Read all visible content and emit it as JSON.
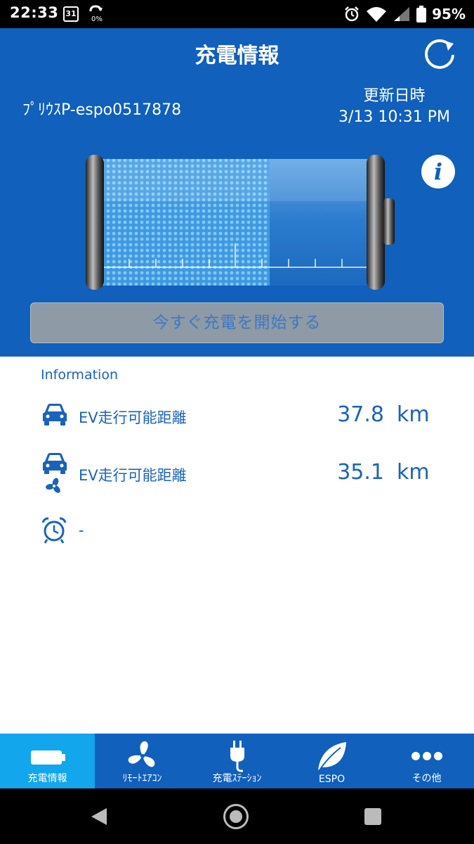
{
  "status_bar": {
    "time": "22:33",
    "calendar_day": "31",
    "battery_percent": "95%"
  },
  "header": {
    "title": "充電情報",
    "vehicle_name": "ﾌﾟﾘｳｽP-espo0517878",
    "update_label": "更新日時",
    "update_time": "3/13 10:31 PM",
    "info_symbol": "i",
    "charge_level": 0.65,
    "charge_button_label": "今すぐ充電を開始する"
  },
  "information": {
    "heading": "Information",
    "rows": [
      {
        "icon": "car-icon",
        "label": "EV走行可能距離",
        "value": "37.8",
        "unit": "km"
      },
      {
        "icon": "car-fan-icon",
        "label": "EV走行可能距離",
        "value": "35.1",
        "unit": "km"
      },
      {
        "icon": "alarm-clock-icon",
        "label": "-"
      }
    ]
  },
  "tabs": [
    {
      "label": "充電情報",
      "icon": "battery-icon",
      "active": true
    },
    {
      "label": "ﾘﾓｰﾄｴｱｺﾝ",
      "icon": "fan-icon",
      "active": false
    },
    {
      "label": "充電ｽﾃｰｼｮﾝ",
      "icon": "plug-icon",
      "active": false
    },
    {
      "label": "ESPO",
      "icon": "leaf-icon",
      "active": false
    },
    {
      "label": "その他",
      "icon": "more-icon",
      "active": false
    }
  ],
  "colors": {
    "primary": "#1060bc",
    "active_tab": "#12a6ec",
    "text_blue": "#1a63b8",
    "button_gray": "#8e9aa5"
  }
}
